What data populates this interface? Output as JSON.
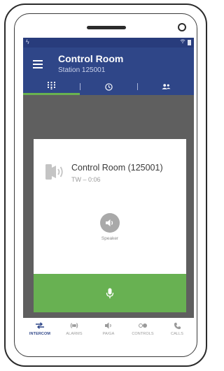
{
  "app": {
    "title": "Control Room",
    "subtitle": "Station 125001"
  },
  "tabs": [
    {
      "icon": "dialpad-icon",
      "active": true
    },
    {
      "icon": "clock-icon",
      "active": false
    },
    {
      "icon": "contacts-icon",
      "active": false
    }
  ],
  "call": {
    "name": "Control Room (125001)",
    "info": "TW – 0:06",
    "speaker_label": "Speaker"
  },
  "bottom_nav": {
    "intercom": "INTERCOM",
    "alarms": "ALARMS",
    "paga": "PA/GA",
    "controls": "CONTROLS",
    "calls": "CALLS"
  },
  "colors": {
    "appbar": "#2f4688",
    "accent": "#69b24f",
    "ptt": "#68b152"
  }
}
